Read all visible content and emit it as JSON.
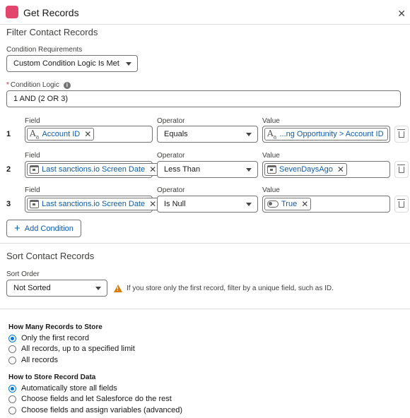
{
  "header": {
    "title": "Get Records",
    "close_glyph": "✕"
  },
  "filter": {
    "section_title": "Filter Contact Records",
    "requirements_label": "Condition Requirements",
    "requirements_value": "Custom Condition Logic Is Met",
    "logic_required_mark": "*",
    "logic_label": "Condition Logic",
    "logic_value": "1 AND (2 OR 3)",
    "col_field": "Field",
    "col_operator": "Operator",
    "col_value": "Value",
    "rows": [
      {
        "num": "1",
        "field": "Account ID",
        "field_type": "text",
        "operator": "Equals",
        "value": "...ng Opportunity > Account ID",
        "value_type": "text"
      },
      {
        "num": "2",
        "field": "Last sanctions.io Screen Date",
        "field_type": "date",
        "operator": "Less Than",
        "value": "SevenDaysAgo",
        "value_type": "date"
      },
      {
        "num": "3",
        "field": "Last sanctions.io Screen Date",
        "field_type": "date",
        "operator": "Is Null",
        "value": "True",
        "value_type": "boolean"
      }
    ],
    "add_condition_label": "Add Condition"
  },
  "sort": {
    "section_title": "Sort Contact Records",
    "order_label": "Sort Order",
    "order_value": "Not Sorted",
    "warning": "If you store only the first record, filter by a unique field, such as ID."
  },
  "store": {
    "how_many_label": "How Many Records to Store",
    "how_many_options": [
      {
        "label": "Only the first record",
        "checked": true
      },
      {
        "label": "All records, up to a specified limit",
        "checked": false
      },
      {
        "label": "All records",
        "checked": false
      }
    ],
    "how_label": "How to Store Record Data",
    "how_options": [
      {
        "label": "Automatically store all fields",
        "checked": true
      },
      {
        "label": "Choose fields and let Salesforce do the rest",
        "checked": false
      },
      {
        "label": "Choose fields and assign variables (advanced)",
        "checked": false
      }
    ]
  },
  "colors": {
    "accent": "#0176d3",
    "link": "#0b5cab",
    "brand_icon": "#e3466c",
    "warning": "#dd7a01"
  },
  "icons": {
    "text_type": "text-type-icon",
    "date_type": "calendar-icon",
    "boolean_type": "toggle-icon"
  }
}
